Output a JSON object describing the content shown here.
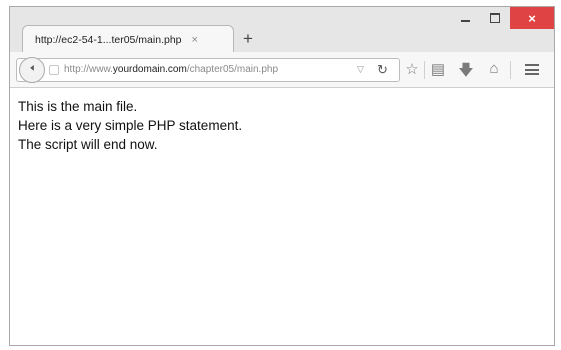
{
  "window": {
    "controls": {
      "close_label": "×"
    }
  },
  "tab": {
    "title": "http://ec2-54-1...ter05/main.php",
    "close_label": "×",
    "new_tab_label": "+"
  },
  "navbar": {
    "url_prefix": "http://www.",
    "url_domain": "yourdomain.com",
    "url_path": "/chapter05/main.php",
    "icons": [
      "back-icon",
      "dropdown-icon",
      "reload-icon",
      "bookmark-star-icon",
      "reading-list-icon",
      "download-icon",
      "home-icon",
      "menu-icon"
    ]
  },
  "content": {
    "lines": [
      "This is the main file.",
      "Here is a very simple PHP statement.",
      "The script will end now."
    ]
  }
}
